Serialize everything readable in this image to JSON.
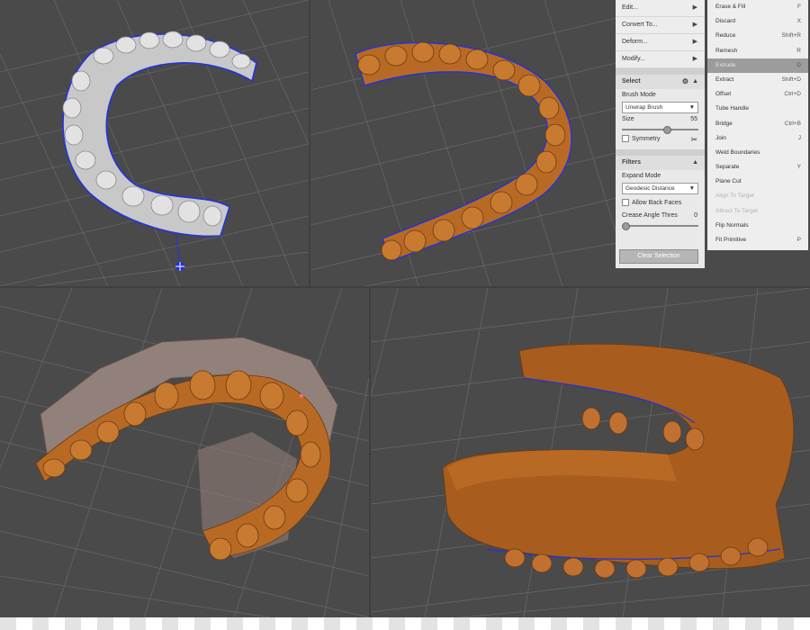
{
  "colors": {
    "viewport_bg": "#4a4a4a",
    "grid_line": "#6a6a6a",
    "model_white": "#c9c9c9",
    "model_orange": "#b86a25",
    "outline_blue": "#2233dd",
    "panel_bg": "#e9e9e9",
    "highlight": "#9c9c9c"
  },
  "menu": {
    "edit": "Edit...",
    "convert": "Convert To...",
    "deform": "Deform...",
    "modify": "Modify...",
    "arrow_icon": "chevron-right-icon"
  },
  "select_panel": {
    "title": "Select",
    "brush_mode_label": "Brush Mode",
    "brush_mode_value": "Unwrap Brush",
    "size_label": "Size",
    "size_value": "55",
    "size_level": 0.6,
    "symmetry_label": "Symmetry",
    "symmetry_checked": false
  },
  "filters_panel": {
    "title": "Filters",
    "expand_mode_label": "Expand Mode",
    "expand_mode_value": "Geodesic Distance",
    "allow_back_faces_label": "Allow Back Faces",
    "allow_back_faces_checked": false,
    "crease_angle_label": "Crease Angle Thres",
    "crease_angle_value": "0",
    "crease_level": 0.0,
    "clear_button": "Clear Selection"
  },
  "context_menu": [
    {
      "label": "Erase & Fill",
      "shortcut": "F",
      "state": "normal"
    },
    {
      "label": "Discard",
      "shortcut": "X",
      "state": "normal"
    },
    {
      "label": "Reduce",
      "shortcut": "Shift+R",
      "state": "normal"
    },
    {
      "label": "Remesh",
      "shortcut": "R",
      "state": "normal"
    },
    {
      "label": "Extrude",
      "shortcut": "D",
      "state": "highlight"
    },
    {
      "label": "Extract",
      "shortcut": "Shift+D",
      "state": "normal"
    },
    {
      "label": "Offset",
      "shortcut": "Ctrl+D",
      "state": "normal"
    },
    {
      "label": "Tube Handle",
      "shortcut": "",
      "state": "normal"
    },
    {
      "label": "Bridge",
      "shortcut": "Ctrl+B",
      "state": "normal"
    },
    {
      "label": "Join",
      "shortcut": "J",
      "state": "normal"
    },
    {
      "label": "Weld Boundaries",
      "shortcut": "",
      "state": "normal"
    },
    {
      "label": "Separate",
      "shortcut": "Y",
      "state": "normal"
    },
    {
      "label": "Plane Cut",
      "shortcut": "",
      "state": "normal"
    },
    {
      "label": "Align To Target",
      "shortcut": "",
      "state": "disabled"
    },
    {
      "label": "Attract To Target",
      "shortcut": "",
      "state": "disabled"
    },
    {
      "label": "Flip Normals",
      "shortcut": "",
      "state": "normal"
    },
    {
      "label": "Fit Primitive",
      "shortcut": "P",
      "state": "normal"
    }
  ]
}
